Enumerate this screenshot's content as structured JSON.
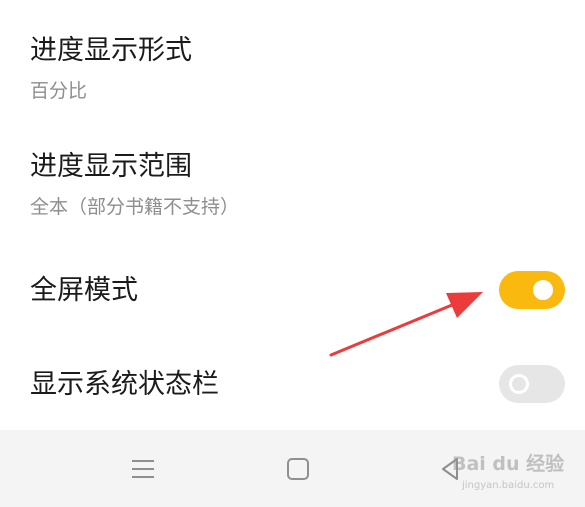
{
  "settings": {
    "progress_display_format": {
      "title": "进度显示形式",
      "value": "百分比"
    },
    "progress_display_range": {
      "title": "进度显示范围",
      "value": "全本（部分书籍不支持）"
    },
    "fullscreen_mode": {
      "title": "全屏模式",
      "enabled": true
    },
    "show_status_bar": {
      "title": "显示系统状态栏",
      "enabled": false
    }
  },
  "colors": {
    "toggle_on": "#f9b90f",
    "toggle_off": "#e6e6e6",
    "annotation_arrow": "#ec3b3b",
    "nav_bar_background": "#f4f4f4"
  },
  "nav_bar": {
    "icons": [
      "menu-icon",
      "home-icon",
      "back-icon"
    ]
  },
  "watermark": {
    "logo": "Bai du 经验",
    "url": "jingyan.baidu.com"
  }
}
